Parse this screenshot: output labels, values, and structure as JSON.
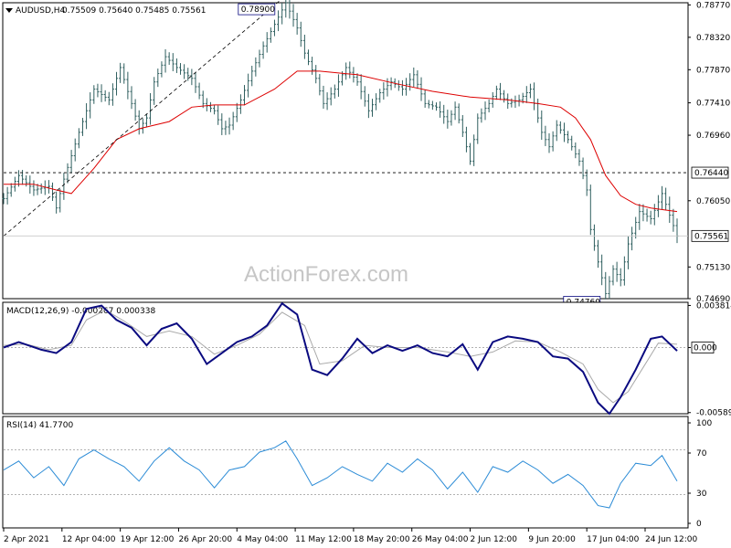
{
  "header": {
    "symbol": "AUDUSD,H4",
    "ohlc": "0.75509 0.75640 0.75485 0.75561"
  },
  "watermark": "ActionForex.com",
  "colors": {
    "bars": "#2f5f5f",
    "ma": "#dd0000",
    "macd": "#0a0a80",
    "signal": "#aaaaaa",
    "rsi": "#2b8bd6",
    "grid": "#cccccc",
    "axis": "#000000"
  },
  "chart_data": [
    {
      "type": "ohlc",
      "panel": "price",
      "ylim": [
        0.7469,
        0.788
      ],
      "y_ticks": [
        "0.78770",
        "0.78320",
        "0.77870",
        "0.77410",
        "0.76960",
        "0.76050",
        "0.75130",
        "0.74690"
      ],
      "x_ticks": [
        "2 Apr 2021",
        "12 Apr 04:00",
        "19 Apr 12:00",
        "26 Apr 20:00",
        "4 May 04:00",
        "11 May 12:00",
        "18 May 20:00",
        "26 May 04:00",
        "2 Jun 12:00",
        "9 Jun 20:00",
        "17 Jun 04:00",
        "24 Jun 12:00"
      ],
      "close_path": [
        [
          0,
          0.7608
        ],
        [
          4,
          0.764
        ],
        [
          8,
          0.762
        ],
        [
          12,
          0.7625
        ],
        [
          14,
          0.7595
        ],
        [
          16,
          0.7635
        ],
        [
          20,
          0.77
        ],
        [
          24,
          0.776
        ],
        [
          28,
          0.7745
        ],
        [
          31,
          0.779
        ],
        [
          34,
          0.774
        ],
        [
          36,
          0.7705
        ],
        [
          38,
          0.772
        ],
        [
          40,
          0.777
        ],
        [
          43,
          0.7805
        ],
        [
          46,
          0.779
        ],
        [
          50,
          0.7775
        ],
        [
          53,
          0.774
        ],
        [
          56,
          0.773
        ],
        [
          58,
          0.7705
        ],
        [
          60,
          0.771
        ],
        [
          63,
          0.7745
        ],
        [
          66,
          0.7785
        ],
        [
          69,
          0.782
        ],
        [
          72,
          0.785
        ],
        [
          75,
          0.788
        ],
        [
          78,
          0.7845
        ],
        [
          80,
          0.781
        ],
        [
          83,
          0.7775
        ],
        [
          85,
          0.774
        ],
        [
          88,
          0.776
        ],
        [
          91,
          0.779
        ],
        [
          94,
          0.777
        ],
        [
          97,
          0.773
        ],
        [
          100,
          0.7755
        ],
        [
          103,
          0.777
        ],
        [
          106,
          0.776
        ],
        [
          109,
          0.778
        ],
        [
          112,
          0.774
        ],
        [
          115,
          0.7735
        ],
        [
          118,
          0.7715
        ],
        [
          120,
          0.7735
        ],
        [
          122,
          0.77
        ],
        [
          124,
          0.766
        ],
        [
          126,
          0.772
        ],
        [
          129,
          0.774
        ],
        [
          131,
          0.776
        ],
        [
          134,
          0.774
        ],
        [
          137,
          0.7745
        ],
        [
          140,
          0.776
        ],
        [
          143,
          0.77
        ],
        [
          145,
          0.768
        ],
        [
          147,
          0.771
        ],
        [
          150,
          0.769
        ],
        [
          153,
          0.766
        ],
        [
          155,
          0.762
        ],
        [
          156,
          0.7565
        ],
        [
          158,
          0.752
        ],
        [
          160,
          0.7476
        ],
        [
          162,
          0.751
        ],
        [
          164,
          0.7495
        ],
        [
          166,
          0.7545
        ],
        [
          169,
          0.759
        ],
        [
          172,
          0.758
        ],
        [
          175,
          0.7615
        ],
        [
          177,
          0.7585
        ],
        [
          179,
          0.7556
        ]
      ],
      "ma_path": [
        [
          0,
          0.7628
        ],
        [
          8,
          0.7628
        ],
        [
          14,
          0.762
        ],
        [
          18,
          0.7615
        ],
        [
          24,
          0.765
        ],
        [
          30,
          0.769
        ],
        [
          36,
          0.7705
        ],
        [
          44,
          0.7715
        ],
        [
          50,
          0.7735
        ],
        [
          56,
          0.7738
        ],
        [
          64,
          0.7738
        ],
        [
          72,
          0.776
        ],
        [
          78,
          0.7785
        ],
        [
          84,
          0.7785
        ],
        [
          94,
          0.778
        ],
        [
          104,
          0.7768
        ],
        [
          114,
          0.7757
        ],
        [
          124,
          0.7749
        ],
        [
          134,
          0.7745
        ],
        [
          142,
          0.774
        ],
        [
          148,
          0.7735
        ],
        [
          152,
          0.772
        ],
        [
          156,
          0.769
        ],
        [
          160,
          0.764
        ],
        [
          164,
          0.7612
        ],
        [
          168,
          0.76
        ],
        [
          172,
          0.7595
        ],
        [
          176,
          0.7592
        ],
        [
          179,
          0.759
        ]
      ],
      "annotations": [
        {
          "label": "0.78900",
          "anchor": "top-left of high",
          "value": 0.789
        },
        {
          "label": "0.74760",
          "anchor": "below low",
          "value": 0.7476
        }
      ],
      "levels": [
        {
          "label": "0.76440",
          "value": 0.7644,
          "style": "dashed"
        },
        {
          "label": "0.75561",
          "value": 0.75561,
          "style": "solid"
        }
      ],
      "trendline": [
        [
          0,
          0.7556
        ],
        [
          75,
          0.789
        ]
      ]
    },
    {
      "type": "line",
      "panel": "macd",
      "title": "MACD(12,26,9) -0.000267 0.000338",
      "ylim": [
        -0.006,
        0.0041
      ],
      "y_ticks": [
        "0.003814",
        "0.00",
        "-0.005895"
      ],
      "right_badge": "0.000",
      "macd_path": [
        [
          0,
          0.0
        ],
        [
          4,
          0.0005
        ],
        [
          10,
          -0.0002
        ],
        [
          14,
          -0.0005
        ],
        [
          18,
          0.0005
        ],
        [
          22,
          0.0035
        ],
        [
          26,
          0.0038
        ],
        [
          30,
          0.0025
        ],
        [
          34,
          0.0018
        ],
        [
          38,
          0.0002
        ],
        [
          42,
          0.0017
        ],
        [
          46,
          0.0022
        ],
        [
          50,
          0.0008
        ],
        [
          54,
          -0.0015
        ],
        [
          58,
          -0.0005
        ],
        [
          62,
          0.0005
        ],
        [
          66,
          0.001
        ],
        [
          70,
          0.002
        ],
        [
          74,
          0.004
        ],
        [
          78,
          0.003
        ],
        [
          82,
          -0.002
        ],
        [
          86,
          -0.0025
        ],
        [
          90,
          -0.001
        ],
        [
          94,
          0.0008
        ],
        [
          98,
          -0.0005
        ],
        [
          102,
          0.0002
        ],
        [
          106,
          -0.0003
        ],
        [
          110,
          0.0002
        ],
        [
          114,
          -0.0005
        ],
        [
          118,
          -0.0008
        ],
        [
          122,
          0.0003
        ],
        [
          126,
          -0.002
        ],
        [
          130,
          0.0005
        ],
        [
          134,
          0.001
        ],
        [
          138,
          0.0008
        ],
        [
          142,
          0.0005
        ],
        [
          146,
          -0.0008
        ],
        [
          150,
          -0.001
        ],
        [
          154,
          -0.0022
        ],
        [
          158,
          -0.005
        ],
        [
          161,
          -0.006
        ],
        [
          164,
          -0.0045
        ],
        [
          168,
          -0.002
        ],
        [
          172,
          0.0008
        ],
        [
          175,
          0.001
        ],
        [
          179,
          -0.0003
        ]
      ],
      "signal_path": [
        [
          0,
          0.0002
        ],
        [
          6,
          0.0003
        ],
        [
          12,
          -0.0002
        ],
        [
          18,
          0.0002
        ],
        [
          22,
          0.0025
        ],
        [
          27,
          0.0034
        ],
        [
          32,
          0.0024
        ],
        [
          38,
          0.001
        ],
        [
          44,
          0.0015
        ],
        [
          50,
          0.001
        ],
        [
          56,
          -0.0006
        ],
        [
          62,
          0.0002
        ],
        [
          68,
          0.0012
        ],
        [
          74,
          0.0032
        ],
        [
          80,
          0.002
        ],
        [
          84,
          -0.0015
        ],
        [
          90,
          -0.0012
        ],
        [
          96,
          0.0002
        ],
        [
          102,
          0.0
        ],
        [
          110,
          0.0
        ],
        [
          118,
          -0.0004
        ],
        [
          124,
          -0.0008
        ],
        [
          130,
          -0.0004
        ],
        [
          136,
          0.0006
        ],
        [
          142,
          0.0005
        ],
        [
          148,
          -0.0004
        ],
        [
          154,
          -0.0015
        ],
        [
          158,
          -0.0038
        ],
        [
          162,
          -0.005
        ],
        [
          166,
          -0.004
        ],
        [
          170,
          -0.0018
        ],
        [
          174,
          0.0004
        ],
        [
          179,
          0.0003
        ]
      ]
    },
    {
      "type": "line",
      "panel": "rsi",
      "title": "RSI(14) 41.7700",
      "ylim": [
        0,
        100
      ],
      "y_ticks": [
        "100",
        "70",
        "30",
        "0"
      ],
      "levels": [
        70,
        30
      ],
      "rsi_path": [
        [
          0,
          52
        ],
        [
          4,
          60
        ],
        [
          8,
          45
        ],
        [
          12,
          55
        ],
        [
          16,
          38
        ],
        [
          20,
          62
        ],
        [
          24,
          70
        ],
        [
          28,
          62
        ],
        [
          32,
          55
        ],
        [
          36,
          42
        ],
        [
          40,
          60
        ],
        [
          44,
          72
        ],
        [
          48,
          60
        ],
        [
          52,
          52
        ],
        [
          56,
          36
        ],
        [
          60,
          52
        ],
        [
          64,
          55
        ],
        [
          68,
          68
        ],
        [
          72,
          72
        ],
        [
          75,
          78
        ],
        [
          78,
          62
        ],
        [
          82,
          38
        ],
        [
          86,
          45
        ],
        [
          90,
          55
        ],
        [
          94,
          48
        ],
        [
          98,
          42
        ],
        [
          102,
          58
        ],
        [
          106,
          50
        ],
        [
          110,
          62
        ],
        [
          114,
          52
        ],
        [
          118,
          35
        ],
        [
          122,
          50
        ],
        [
          126,
          32
        ],
        [
          130,
          55
        ],
        [
          134,
          50
        ],
        [
          138,
          60
        ],
        [
          142,
          52
        ],
        [
          146,
          40
        ],
        [
          150,
          48
        ],
        [
          154,
          38
        ],
        [
          158,
          20
        ],
        [
          161,
          18
        ],
        [
          164,
          40
        ],
        [
          168,
          58
        ],
        [
          172,
          56
        ],
        [
          175,
          65
        ],
        [
          179,
          42
        ]
      ]
    }
  ]
}
